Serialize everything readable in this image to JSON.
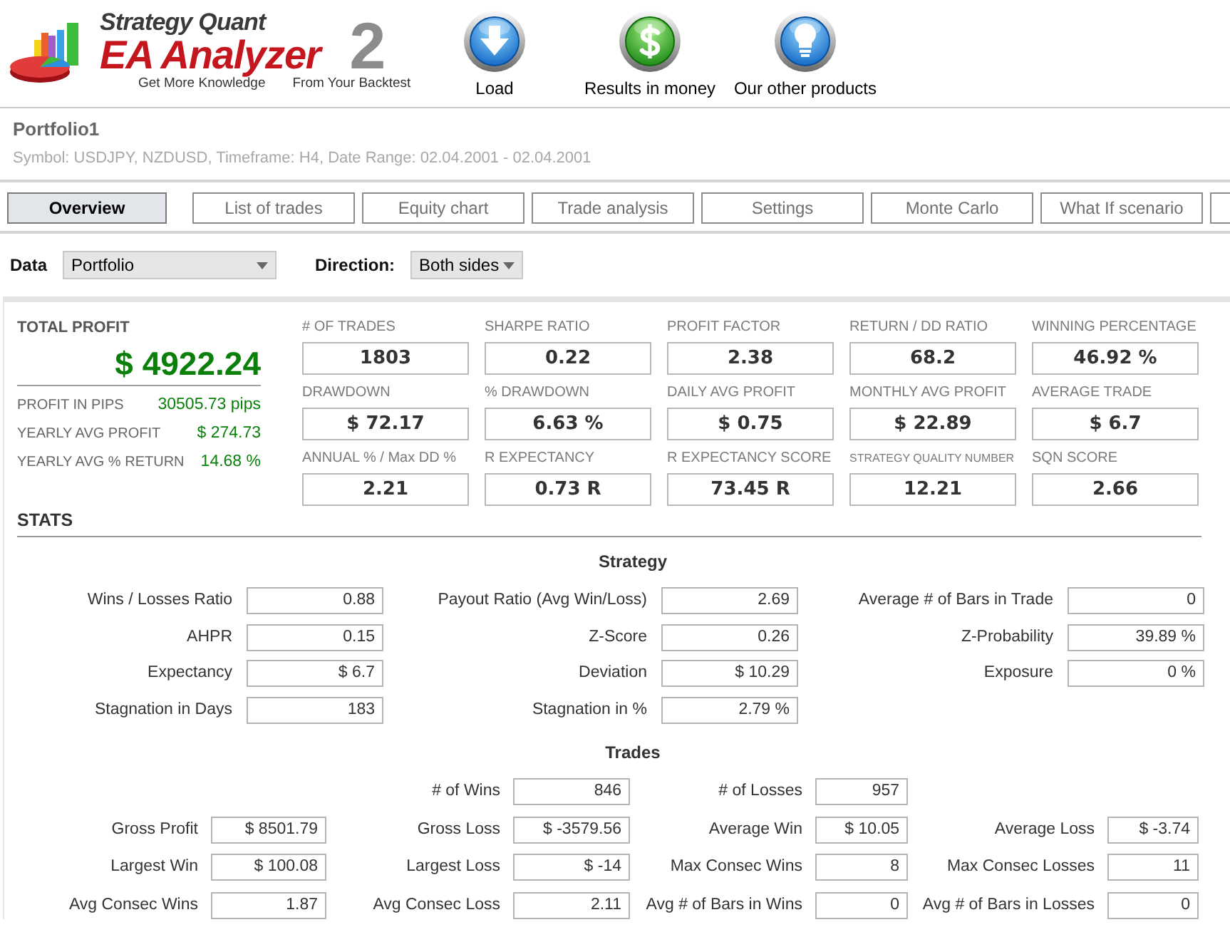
{
  "header": {
    "logo": {
      "brand": "Strategy Quant",
      "product": "EA Analyzer",
      "version": "2",
      "taglines": [
        "Get More Knowledge",
        "From Your Backtest"
      ]
    },
    "toolbar": [
      {
        "kind": "download",
        "label": "Load"
      },
      {
        "kind": "money",
        "label": "Results in money"
      },
      {
        "kind": "idea",
        "label": "Our other products"
      }
    ]
  },
  "portfolio": {
    "title": "Portfolio1",
    "details": "Symbol: USDJPY, NZDUSD, Timeframe: H4, Date Range: 02.04.2001 - 02.04.2001"
  },
  "tabs": [
    {
      "label": "Overview",
      "selected": true
    },
    {
      "label": "List of trades",
      "selected": false
    },
    {
      "label": "Equity chart",
      "selected": false
    },
    {
      "label": "Trade analysis",
      "selected": false
    },
    {
      "label": "Settings",
      "selected": false
    },
    {
      "label": "Monte Carlo",
      "selected": false
    },
    {
      "label": "What If scenario",
      "selected": false
    },
    {
      "selected": false
    }
  ],
  "filters": [
    {
      "label": "Data",
      "value": "Portfolio"
    },
    {
      "label": "Direction:",
      "value": "Both sides"
    }
  ],
  "total_profit": {
    "label": "TOTAL PROFIT",
    "value": "$ 4922.24",
    "details": [
      {
        "label": "PROFIT IN PIPS",
        "value": "30505.73 pips"
      },
      {
        "label": "YEARLY AVG PROFIT",
        "value": "$ 274.73"
      },
      {
        "label": "YEARLY AVG % RETURN",
        "value": "14.68 %"
      }
    ]
  },
  "metrics": [
    {
      "label": "# OF TRADES",
      "value": "1803"
    },
    {
      "label": "SHARPE RATIO",
      "value": "0.22"
    },
    {
      "label": "PROFIT FACTOR",
      "value": "2.38"
    },
    {
      "label": "RETURN / DD RATIO",
      "value": "68.2"
    },
    {
      "label": "WINNING PERCENTAGE",
      "value": "46.92 %"
    },
    {
      "label": "DRAWDOWN",
      "value": "$ 72.17"
    },
    {
      "label": "% DRAWDOWN",
      "value": "6.63 %"
    },
    {
      "label": "DAILY AVG PROFIT",
      "value": "$ 0.75"
    },
    {
      "label": "MONTHLY AVG PROFIT",
      "value": "$ 22.89"
    },
    {
      "label": "AVERAGE TRADE",
      "value": "$ 6.7"
    },
    {
      "label": "ANNUAL % / Max DD %",
      "value": "2.21"
    },
    {
      "label": "R EXPECTANCY",
      "value": "0.73 R"
    },
    {
      "label": "R EXPECTANCY SCORE",
      "value": "73.45 R"
    },
    {
      "label": "STRATEGY QUALITY NUMBER",
      "value": "12.21"
    },
    {
      "label": "SQN SCORE",
      "value": "2.66"
    }
  ],
  "stats": {
    "title": "STATS",
    "sections": [
      {
        "title": "Strategy",
        "rows": [
          [
            {
              "label": "Wins / Losses Ratio",
              "value": "0.88"
            },
            {
              "label": "Payout Ratio (Avg Win/Loss)",
              "value": "2.69"
            },
            {
              "label": "Average # of Bars in Trade",
              "value": "0"
            }
          ],
          [
            {
              "label": "AHPR",
              "value": "0.15"
            },
            {
              "label": "Z-Score",
              "value": "0.26"
            },
            {
              "label": "Z-Probability",
              "value": "39.89 %"
            }
          ],
          [
            {
              "label": "Expectancy",
              "value": "$ 6.7"
            },
            {
              "label": "Deviation",
              "value": "$ 10.29"
            },
            {
              "label": "Exposure",
              "value": "0 %"
            }
          ],
          [
            {
              "label": "Stagnation in Days",
              "value": "183"
            },
            {
              "label": "Stagnation in %",
              "value": "2.79 %"
            },
            null
          ]
        ]
      },
      {
        "title": "Trades",
        "rows": [
          [
            null,
            {
              "label": "# of Wins",
              "value": "846"
            },
            {
              "label": "# of Losses",
              "value": "957"
            },
            null
          ],
          [
            {
              "label": "Gross Profit",
              "value": "$ 8501.79"
            },
            {
              "label": "Gross Loss",
              "value": "$ -3579.56"
            },
            {
              "label": "Average Win",
              "value": "$ 10.05"
            },
            {
              "label": "Average Loss",
              "value": "$ -3.74"
            }
          ],
          [
            {
              "label": "Largest Win",
              "value": "$ 100.08"
            },
            {
              "label": "Largest Loss",
              "value": "$ -14"
            },
            {
              "label": "Max Consec Wins",
              "value": "8"
            },
            {
              "label": "Max Consec Losses",
              "value": "11"
            }
          ],
          [
            {
              "label": "Avg Consec Wins",
              "value": "1.87"
            },
            {
              "label": "Avg Consec Loss",
              "value": "2.11"
            },
            {
              "label": "Avg # of Bars in Wins",
              "value": "0"
            },
            {
              "label": "Avg # of Bars in Losses",
              "value": "0"
            }
          ]
        ]
      }
    ]
  }
}
